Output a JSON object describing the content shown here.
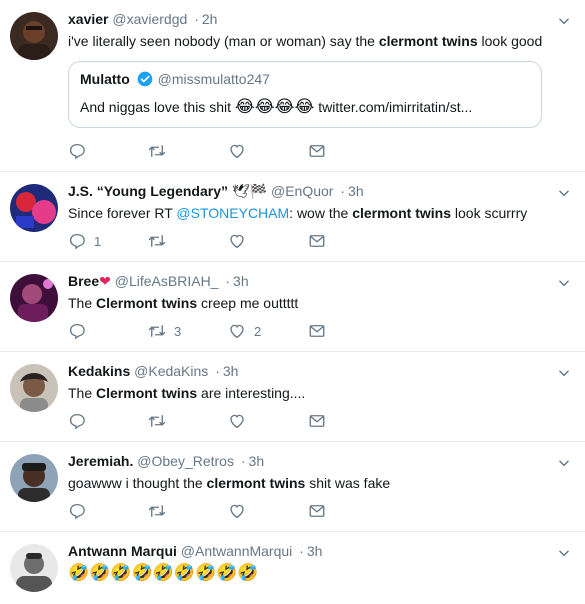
{
  "tweets": [
    {
      "name": "xavier",
      "handle": "@xavierdgd",
      "time": "2h",
      "text_before": "i've literally seen nobody (man or woman) say the ",
      "bold": "clermont twins",
      "text_after": " look good",
      "quote": {
        "name": "Mulatto",
        "handle": "@missmulatto247",
        "text": "And niggas love this shit ",
        "emojis": "😂😂😂😂",
        "link": " twitter.com/imirritatin/st..."
      },
      "reply_count": "",
      "retweet_count": "",
      "like_count": ""
    },
    {
      "name": "J.S. “Young Legendary”",
      "name_emojis": "🕊🏁",
      "handle": "@EnQuor",
      "time": "3h",
      "text_before": "Since forever RT ",
      "mention": "@STONEYCHAM",
      "text_mid": ": wow the ",
      "bold": "clermont twins",
      "text_after": " look scurrry",
      "reply_count": "1",
      "retweet_count": "",
      "like_count": ""
    },
    {
      "name": "Bree",
      "name_emojis": "❤",
      "handle": "@LifeAsBRIAH_",
      "time": "3h",
      "text_before": "The ",
      "bold": "Clermont twins",
      "text_after": " creep me outtttt",
      "reply_count": "",
      "retweet_count": "3",
      "like_count": "2"
    },
    {
      "name": "Kedakins",
      "handle": "@KedaKins",
      "time": "3h",
      "text_before": "The ",
      "bold": "Clermont twins",
      "text_after": " are interesting....",
      "reply_count": "",
      "retweet_count": "",
      "like_count": ""
    },
    {
      "name": "Jeremiah.",
      "handle": "@Obey_Retros",
      "time": "3h",
      "text_before": "goawww i thought the ",
      "bold": "clermont twins",
      "text_after": " shit was fake",
      "reply_count": "",
      "retweet_count": "",
      "like_count": ""
    },
    {
      "name": "Antwann Marqui",
      "handle": "@AntwannMarqui",
      "time": "3h",
      "text_emojis": "🤣🤣🤣🤣🤣🤣🤣🤣🤣"
    }
  ],
  "dot": "·",
  "colors": {
    "text": "#14171a",
    "secondary": "#657786",
    "link": "#1b95e0",
    "border": "#e6ecf0"
  },
  "icons": [
    "reply-icon",
    "retweet-icon",
    "like-icon",
    "dm-icon",
    "chevron-down-icon",
    "verified-icon"
  ]
}
